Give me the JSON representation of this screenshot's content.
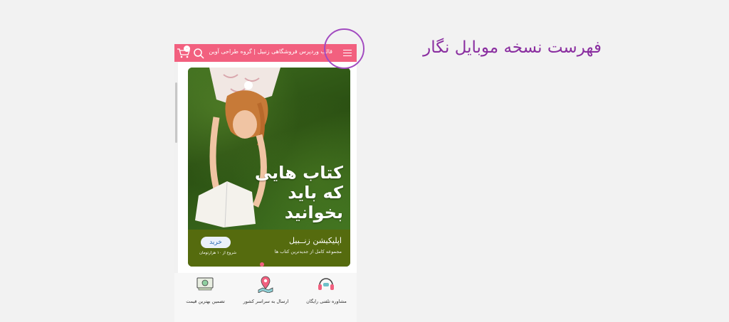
{
  "page": {
    "heading": "فهرست نسخه موبایل نگار",
    "colors": {
      "accent": "#f2607f",
      "heading": "#8a2ea0",
      "banner_bar": "#556b0e",
      "ring": "#a24bc0"
    }
  },
  "topbar": {
    "title": "قالب وردپرس فروشگاهی زنبیل | گروه طراحی آوین",
    "cart_count": "۰",
    "icons": [
      "menu-icon",
      "search-icon",
      "cart-icon"
    ]
  },
  "banner": {
    "headline": "کتاب هایی که باید بخوانید",
    "app_name": "اپلیکیشن زنــبیل",
    "app_sub": "مجموعه کامل از جدیدترین کتاب ها",
    "buy_label": "خرید",
    "price_note": "شروع از ۱۰ هزارتومان"
  },
  "features": [
    {
      "label": "مشاوره تلفنی رایگان",
      "icon": "headset-icon"
    },
    {
      "label": "ارسال به سراسر کشور",
      "icon": "map-pin-icon"
    },
    {
      "label": "تضمین بهترین قیمت",
      "icon": "money-icon"
    }
  ]
}
